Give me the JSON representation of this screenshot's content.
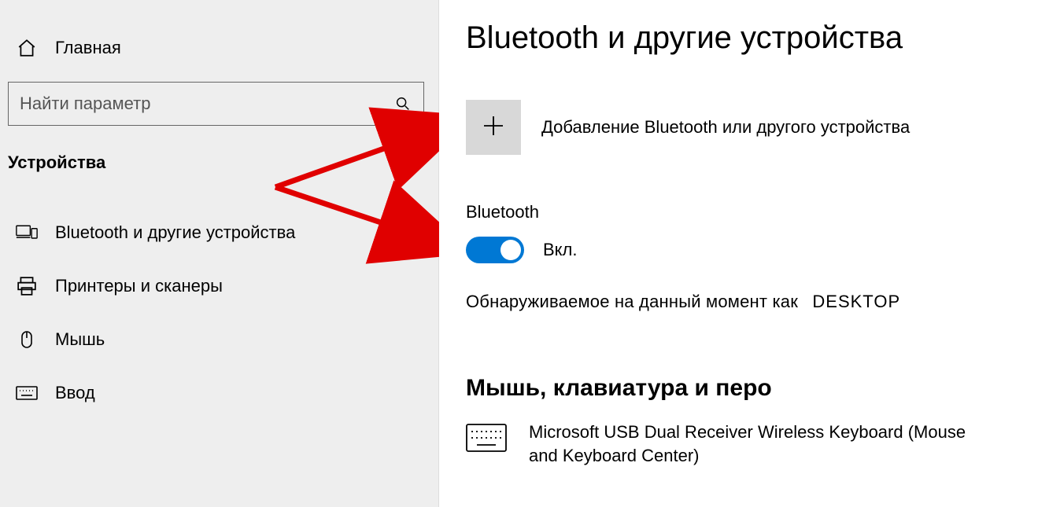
{
  "sidebar": {
    "home_label": "Главная",
    "search_placeholder": "Найти параметр",
    "category_heading": "Устройства",
    "items": [
      {
        "label": "Bluetooth и другие устройства"
      },
      {
        "label": "Принтеры и сканеры"
      },
      {
        "label": "Мышь"
      },
      {
        "label": "Ввод"
      }
    ]
  },
  "main": {
    "title": "Bluetooth и другие устройства",
    "add_label": "Добавление Bluetooth или другого устройства",
    "bt_label": "Bluetooth",
    "toggle_state": "Вкл.",
    "discoverable_prefix": "Обнаруживаемое на данный момент как",
    "discoverable_name": "DESKTOP",
    "section2_title": "Мышь, клавиатура и перо",
    "device1_name": "Microsoft USB Dual Receiver Wireless Keyboard (Mouse and Keyboard Center)"
  }
}
